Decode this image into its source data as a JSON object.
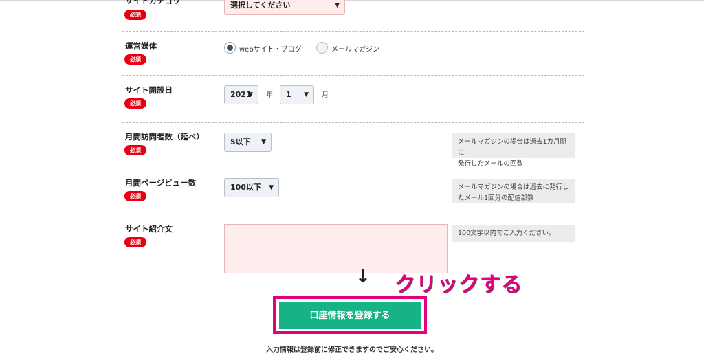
{
  "fields": {
    "category": {
      "label": "サイトカテゴリ",
      "required": "必須",
      "select_value": "選択してください"
    },
    "media": {
      "label": "運営媒体",
      "required": "必須",
      "options": [
        {
          "label": "webサイト・ブログ",
          "selected": true
        },
        {
          "label": "メールマガジン",
          "selected": false
        }
      ]
    },
    "opened": {
      "label": "サイト開設日",
      "required": "必須",
      "year_value": "2021",
      "year_unit": "年",
      "month_value": "1",
      "month_unit": "月"
    },
    "visitors": {
      "label": "月間訪問者数（延べ）",
      "required": "必須",
      "select_value": "5以下",
      "note_line1": "メールマガジンの場合は過去1カ月間に",
      "note_line2": "発行したメールの回数"
    },
    "pageviews": {
      "label": "月間ページビュー数",
      "required": "必須",
      "select_value": "100以下",
      "note_line1": "メールマガジンの場合は過去に発行し",
      "note_line2": "たメール1回分の配信部数"
    },
    "intro": {
      "label": "サイト紹介文",
      "required": "必須",
      "value": "",
      "note": "100文字以内でご入力ください。"
    }
  },
  "annotation": {
    "arrow": "↓",
    "text": "クリックする"
  },
  "submit_label": "口座情報を登録する",
  "footnote": "入力情報は登録前に修正できますのでご安心ください。",
  "colors": {
    "required_badge": "#e60012",
    "submit": "#17b386",
    "highlight": "#e6007e"
  }
}
